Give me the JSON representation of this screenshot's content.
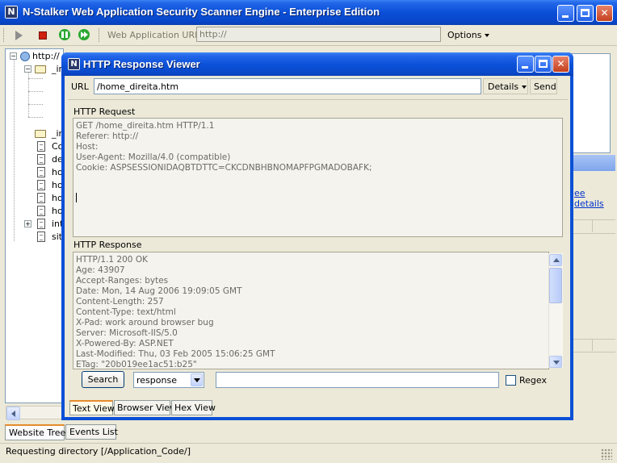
{
  "window": {
    "title": "N-Stalker Web Application Security Scanner Engine - Enterprise Edition",
    "icon_letter": "N"
  },
  "toolbar": {
    "url_label": "Web Application URL :",
    "url_value": "http://",
    "options_label": "Options",
    "icons": [
      "play-icon",
      "stop-icon",
      "pause-icon",
      "fast-forward-icon"
    ]
  },
  "tree": {
    "root_label": "http://",
    "items": [
      {
        "label": "_ir",
        "type": "folder"
      },
      {
        "label": "_ir",
        "type": "folder"
      },
      {
        "label": "Co",
        "type": "file"
      },
      {
        "label": "de",
        "type": "file"
      },
      {
        "label": "ho",
        "type": "file"
      },
      {
        "label": "ho",
        "type": "file"
      },
      {
        "label": "ho",
        "type": "file"
      },
      {
        "label": "ho",
        "type": "file"
      },
      {
        "label": "int",
        "type": "file"
      },
      {
        "label": "sit",
        "type": "file"
      }
    ]
  },
  "bottom_tabs": [
    {
      "label": "Website Tree",
      "active": true
    },
    {
      "label": "Events List",
      "active": false
    }
  ],
  "right_panel": {
    "link_text": "ee details"
  },
  "status": {
    "text": "Requesting directory [/Application_Code/]"
  },
  "dialog": {
    "title": "HTTP Response Viewer",
    "icon_letter": "N",
    "url_label": "URL",
    "url_value": "/home_direita.htm",
    "details_label": "Details",
    "send_label": "Send",
    "request_label": "HTTP Request",
    "request_text": "GET /home_direita.htm HTTP/1.1\nReferer: http://\nHost:\nUser-Agent: Mozilla/4.0 (compatible)\nCookie: ASPSESSIONIDAQBTDTTC=CKCDNBHBNOMAPFPGMADOBAFK;",
    "response_label": "HTTP Response",
    "response_text": "HTTP/1.1 200 OK\nAge: 43907\nAccept-Ranges: bytes\nDate: Mon, 14 Aug 2006 19:09:05 GMT\nContent-Length: 257\nContent-Type: text/html\nX-Pad: work around browser bug\nServer: Microsoft-IIS/5.0\nX-Powered-By: ASP.NET\nLast-Modified: Thu, 03 Feb 2005 15:06:25 GMT\nETag: \"20b019ee1ac51:b25\"",
    "search_label": "Search",
    "search_scope": "response",
    "search_value": "",
    "regex_label": "Regex",
    "regex_checked": false,
    "tabs": [
      {
        "label": "Text View",
        "active": true
      },
      {
        "label": "Browser View",
        "active": false
      },
      {
        "label": "Hex View",
        "active": false
      }
    ]
  },
  "colors": {
    "title_blue": "#0a50d6",
    "window_bg": "#ece9d8",
    "tab_highlight": "#e68b2c",
    "link_blue": "#0033cc"
  }
}
